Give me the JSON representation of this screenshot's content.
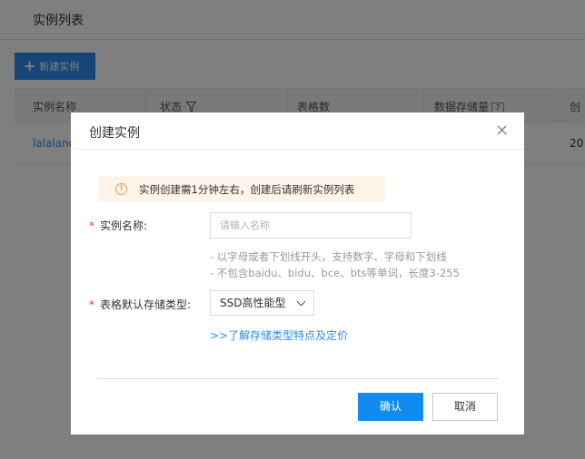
{
  "page": {
    "title": "实例列表",
    "create_button": "新建实例",
    "table": {
      "columns": [
        "实例名称",
        "状态",
        "表格数",
        "数据存储量",
        "创"
      ],
      "help_mark": "?",
      "rows": [
        {
          "name": "lalaland",
          "created": "20"
        }
      ]
    }
  },
  "modal": {
    "title": "创建实例",
    "close_symbol": "×",
    "notice": "实例创建需1分钟左右，创建后请刷新实例列表",
    "notice_icon": "!",
    "name_field": {
      "required_mark": "*",
      "label": "实例名称:",
      "placeholder": "请输入名称",
      "value": "",
      "hints": [
        "- 以字母或者下划线开头，支持数字、字母和下划线",
        "- 不包含baidu、bidu、bce、bts等单词，长度3-255"
      ]
    },
    "storage_field": {
      "required_mark": "*",
      "label": "表格默认存储类型:",
      "selected": "SSD高性能型"
    },
    "learn_link": ">>了解存储类型特点及定价",
    "confirm": "确认",
    "cancel": "取消"
  },
  "colors": {
    "primary": "#108cee",
    "link": "#2d8cf0",
    "required": "#e5363b",
    "notice_bg": "#fdf4ea",
    "notice_icon": "#f29a3b"
  }
}
